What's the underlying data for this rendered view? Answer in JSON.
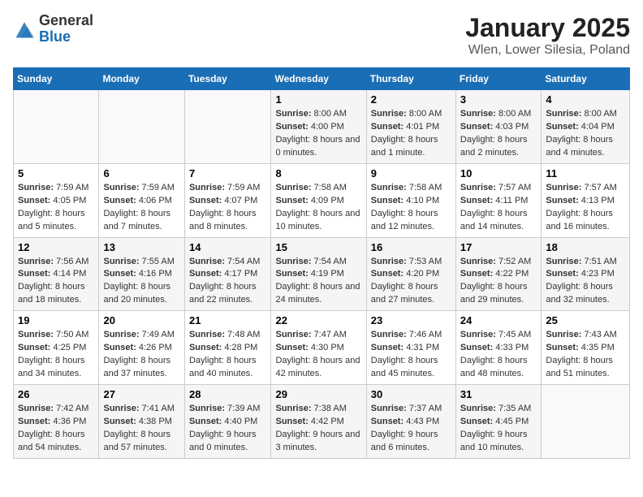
{
  "header": {
    "logo_general": "General",
    "logo_blue": "Blue",
    "title": "January 2025",
    "subtitle": "Wlen, Lower Silesia, Poland"
  },
  "days_of_week": [
    "Sunday",
    "Monday",
    "Tuesday",
    "Wednesday",
    "Thursday",
    "Friday",
    "Saturday"
  ],
  "weeks": [
    [
      {
        "day": "",
        "info": ""
      },
      {
        "day": "",
        "info": ""
      },
      {
        "day": "",
        "info": ""
      },
      {
        "day": "1",
        "info": "Sunrise: 8:00 AM\nSunset: 4:00 PM\nDaylight: 8 hours and 0 minutes."
      },
      {
        "day": "2",
        "info": "Sunrise: 8:00 AM\nSunset: 4:01 PM\nDaylight: 8 hours and 1 minute."
      },
      {
        "day": "3",
        "info": "Sunrise: 8:00 AM\nSunset: 4:03 PM\nDaylight: 8 hours and 2 minutes."
      },
      {
        "day": "4",
        "info": "Sunrise: 8:00 AM\nSunset: 4:04 PM\nDaylight: 8 hours and 4 minutes."
      }
    ],
    [
      {
        "day": "5",
        "info": "Sunrise: 7:59 AM\nSunset: 4:05 PM\nDaylight: 8 hours and 5 minutes."
      },
      {
        "day": "6",
        "info": "Sunrise: 7:59 AM\nSunset: 4:06 PM\nDaylight: 8 hours and 7 minutes."
      },
      {
        "day": "7",
        "info": "Sunrise: 7:59 AM\nSunset: 4:07 PM\nDaylight: 8 hours and 8 minutes."
      },
      {
        "day": "8",
        "info": "Sunrise: 7:58 AM\nSunset: 4:09 PM\nDaylight: 8 hours and 10 minutes."
      },
      {
        "day": "9",
        "info": "Sunrise: 7:58 AM\nSunset: 4:10 PM\nDaylight: 8 hours and 12 minutes."
      },
      {
        "day": "10",
        "info": "Sunrise: 7:57 AM\nSunset: 4:11 PM\nDaylight: 8 hours and 14 minutes."
      },
      {
        "day": "11",
        "info": "Sunrise: 7:57 AM\nSunset: 4:13 PM\nDaylight: 8 hours and 16 minutes."
      }
    ],
    [
      {
        "day": "12",
        "info": "Sunrise: 7:56 AM\nSunset: 4:14 PM\nDaylight: 8 hours and 18 minutes."
      },
      {
        "day": "13",
        "info": "Sunrise: 7:55 AM\nSunset: 4:16 PM\nDaylight: 8 hours and 20 minutes."
      },
      {
        "day": "14",
        "info": "Sunrise: 7:54 AM\nSunset: 4:17 PM\nDaylight: 8 hours and 22 minutes."
      },
      {
        "day": "15",
        "info": "Sunrise: 7:54 AM\nSunset: 4:19 PM\nDaylight: 8 hours and 24 minutes."
      },
      {
        "day": "16",
        "info": "Sunrise: 7:53 AM\nSunset: 4:20 PM\nDaylight: 8 hours and 27 minutes."
      },
      {
        "day": "17",
        "info": "Sunrise: 7:52 AM\nSunset: 4:22 PM\nDaylight: 8 hours and 29 minutes."
      },
      {
        "day": "18",
        "info": "Sunrise: 7:51 AM\nSunset: 4:23 PM\nDaylight: 8 hours and 32 minutes."
      }
    ],
    [
      {
        "day": "19",
        "info": "Sunrise: 7:50 AM\nSunset: 4:25 PM\nDaylight: 8 hours and 34 minutes."
      },
      {
        "day": "20",
        "info": "Sunrise: 7:49 AM\nSunset: 4:26 PM\nDaylight: 8 hours and 37 minutes."
      },
      {
        "day": "21",
        "info": "Sunrise: 7:48 AM\nSunset: 4:28 PM\nDaylight: 8 hours and 40 minutes."
      },
      {
        "day": "22",
        "info": "Sunrise: 7:47 AM\nSunset: 4:30 PM\nDaylight: 8 hours and 42 minutes."
      },
      {
        "day": "23",
        "info": "Sunrise: 7:46 AM\nSunset: 4:31 PM\nDaylight: 8 hours and 45 minutes."
      },
      {
        "day": "24",
        "info": "Sunrise: 7:45 AM\nSunset: 4:33 PM\nDaylight: 8 hours and 48 minutes."
      },
      {
        "day": "25",
        "info": "Sunrise: 7:43 AM\nSunset: 4:35 PM\nDaylight: 8 hours and 51 minutes."
      }
    ],
    [
      {
        "day": "26",
        "info": "Sunrise: 7:42 AM\nSunset: 4:36 PM\nDaylight: 8 hours and 54 minutes."
      },
      {
        "day": "27",
        "info": "Sunrise: 7:41 AM\nSunset: 4:38 PM\nDaylight: 8 hours and 57 minutes."
      },
      {
        "day": "28",
        "info": "Sunrise: 7:39 AM\nSunset: 4:40 PM\nDaylight: 9 hours and 0 minutes."
      },
      {
        "day": "29",
        "info": "Sunrise: 7:38 AM\nSunset: 4:42 PM\nDaylight: 9 hours and 3 minutes."
      },
      {
        "day": "30",
        "info": "Sunrise: 7:37 AM\nSunset: 4:43 PM\nDaylight: 9 hours and 6 minutes."
      },
      {
        "day": "31",
        "info": "Sunrise: 7:35 AM\nSunset: 4:45 PM\nDaylight: 9 hours and 10 minutes."
      },
      {
        "day": "",
        "info": ""
      }
    ]
  ]
}
